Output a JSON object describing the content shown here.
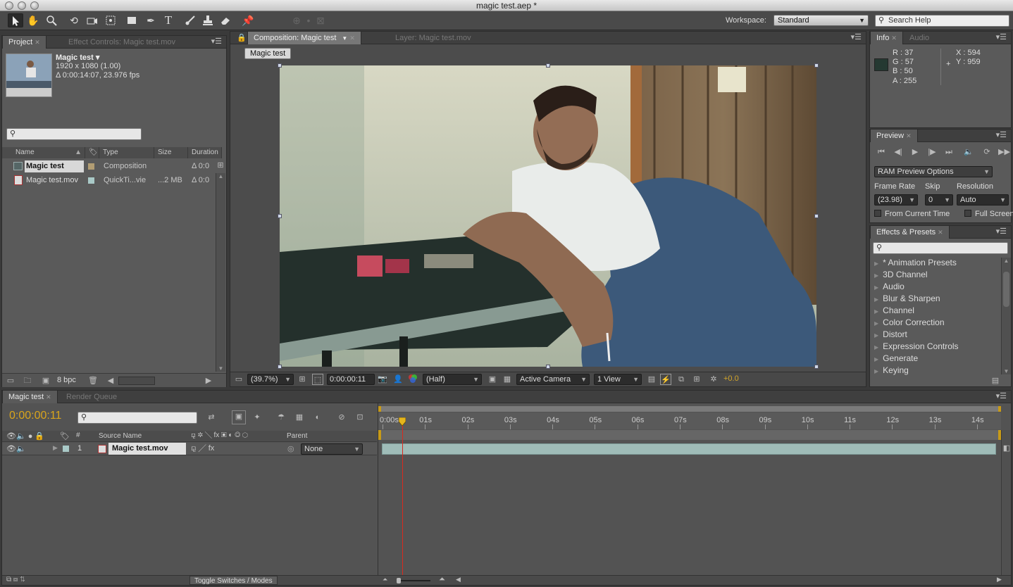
{
  "window": {
    "title": "magic test.aep *"
  },
  "toolbar": {
    "tools": [
      "selection-tool",
      "hand-tool",
      "zoom-tool",
      "rotation-tool",
      "camera-tool",
      "pan-behind-tool",
      "rectangle-tool",
      "pen-tool",
      "type-tool",
      "brush-tool",
      "clone-stamp-tool",
      "eraser-tool",
      "puppet-pin-tool"
    ],
    "workspace_label": "Workspace:",
    "workspace_value": "Standard",
    "search_help": "Search Help"
  },
  "project": {
    "tabs": [
      "Project",
      "Effect Controls: Magic test.mov"
    ],
    "thumb_name": "Magic test ▾",
    "thumb_res": "1920 x 1080 (1.00)",
    "thumb_dur": "Δ 0:00:14:07, 23.976 fps",
    "columns": [
      "Name",
      "Type",
      "Size",
      "Duration"
    ],
    "items": [
      {
        "name": "Magic test",
        "type": "Composition",
        "size": "",
        "duration": "Δ 0:0",
        "label_color": "#b29d73"
      },
      {
        "name": "Magic test.mov",
        "type": "QuickTi...vie",
        "size": "...2 MB",
        "duration": "Δ 0:0",
        "label_color": "#a9c9c7"
      }
    ],
    "bpc": "8 bpc"
  },
  "composition": {
    "tabs": [
      "Composition: Magic test",
      "Layer: Magic test.mov"
    ],
    "comp_button": "Magic test",
    "zoom": "(39.7%)",
    "timecode": "0:00:00:11",
    "resolution": "(Half)",
    "camera": "Active Camera",
    "view": "1 View",
    "exposure": "+0.0"
  },
  "info": {
    "tabs": [
      "Info",
      "Audio"
    ],
    "r": "R : 37",
    "g": "G : 57",
    "b": "B : 50",
    "a": "A : 255",
    "x": "X : 594",
    "y": "Y : 959",
    "swatch_color": "#253932"
  },
  "preview": {
    "tab": "Preview",
    "ram_preview": "RAM Preview Options",
    "frame_rate_label": "Frame Rate",
    "skip_label": "Skip",
    "resolution_label": "Resolution",
    "frame_rate_value": "(23.98)",
    "skip_value": "0",
    "resolution_value": "Auto",
    "from_current_time": "From Current Time",
    "full_screen": "Full Screen"
  },
  "effects": {
    "tab": "Effects & Presets",
    "items": [
      "* Animation Presets",
      "3D Channel",
      "Audio",
      "Blur & Sharpen",
      "Channel",
      "Color Correction",
      "Distort",
      "Expression Controls",
      "Generate",
      "Keying"
    ]
  },
  "timeline": {
    "tabs": [
      "Magic test",
      "Render Queue"
    ],
    "timecode": "0:00:00:11",
    "col_hash": "#",
    "col_source": "Source Name",
    "col_parent": "Parent",
    "layer_num": "1",
    "layer_name": "Magic test.mov",
    "parent_value": "None",
    "ruler": [
      "0:00s",
      "01s",
      "02s",
      "03s",
      "04s",
      "05s",
      "06s",
      "07s",
      "08s",
      "09s",
      "10s",
      "11s",
      "12s",
      "13s",
      "14s"
    ],
    "toggle": "Toggle Switches / Modes",
    "duration_seconds": 14.3,
    "current_time_seconds": 0.46
  }
}
